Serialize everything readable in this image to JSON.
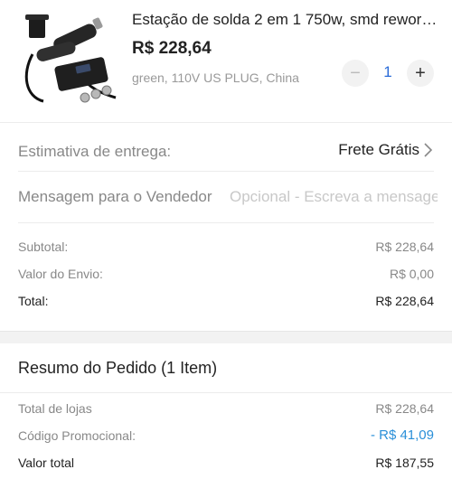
{
  "product": {
    "title": "Estação de solda 2 em 1 750w, smd rewor…",
    "price": "R$ 228,64",
    "variant": "green, 110V US PLUG, China",
    "quantity": "1",
    "minus_label": "−",
    "plus_label": "+"
  },
  "delivery": {
    "label": "Estimativa de entrega:",
    "value": "Frete Grátis"
  },
  "seller_message": {
    "label": "Mensagem para o Vendedor",
    "placeholder": "Opcional - Escreva a mensage"
  },
  "costs": {
    "subtotal_label": "Subtotal:",
    "subtotal_value": "R$ 228,64",
    "shipping_label": "Valor do Envio:",
    "shipping_value": "R$ 0,00",
    "total_label": "Total:",
    "total_value": "R$ 228,64"
  },
  "order_summary": {
    "title": "Resumo do Pedido (1 Item)",
    "stores_label": "Total de lojas",
    "stores_value": "R$ 228,64",
    "promo_label": "Código Promocional:",
    "promo_value": "- R$ 41,09",
    "grand_label": "Valor total",
    "grand_value": "R$ 187,55"
  },
  "colors": {
    "accent_blue": "#2a6bd8",
    "discount_blue": "#2a8fd8",
    "muted_text": "#888888"
  }
}
